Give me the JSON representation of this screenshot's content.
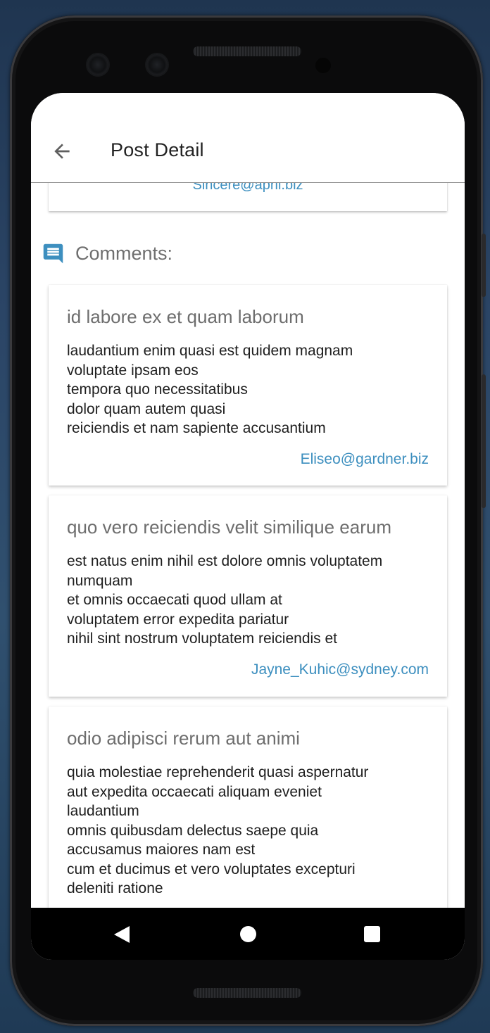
{
  "header": {
    "title": "Post Detail"
  },
  "post": {
    "author_email": "Sincere@april.biz"
  },
  "comments_section": {
    "label": "Comments:",
    "icon": "comment-icon",
    "accent_color": "#3d8fbf"
  },
  "comments": [
    {
      "name": "id labore ex et quam laborum",
      "body": "laudantium enim quasi est quidem magnam\nvoluptate ipsam eos\ntempora quo necessitatibus\ndolor quam autem quasi\nreiciendis et nam sapiente accusantium",
      "email": "Eliseo@gardner.biz"
    },
    {
      "name": "quo vero reiciendis velit similique earum",
      "body": "est natus enim nihil est dolore omnis voluptatem\nnumquam\net omnis occaecati quod ullam at\nvoluptatem error expedita pariatur\nnihil sint nostrum voluptatem reiciendis et",
      "email": "Jayne_Kuhic@sydney.com"
    },
    {
      "name": "odio adipisci rerum aut animi",
      "body": "quia molestiae reprehenderit quasi aspernatur\naut expedita occaecati aliquam eveniet\nlaudantium\nomnis quibusdam delectus saepe quia\naccusamus maiores nam est\ncum et ducimus et vero voluptates excepturi\ndeleniti ratione",
      "email": ""
    }
  ],
  "navigation_bar": {
    "back": "back-triangle-icon",
    "home": "home-circle-icon",
    "recents": "recents-square-icon"
  }
}
